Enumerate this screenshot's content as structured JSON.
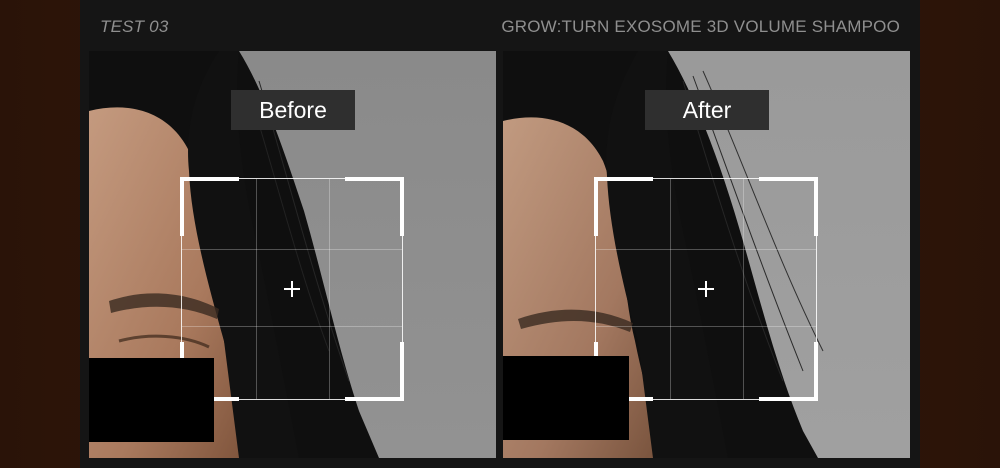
{
  "header": {
    "test_label": "TEST 03",
    "product_name": "GROW:TURN EXOSOME 3D VOLUME SHAMPOO"
  },
  "panels": [
    {
      "id": "before",
      "label": "Before"
    },
    {
      "id": "after",
      "label": "After"
    }
  ],
  "icons": {
    "crosshair": "crosshair-icon"
  },
  "colors": {
    "background_outer": "#3a1c0c",
    "panel": "#151515",
    "header_text": "#8f8f8f",
    "label_bg": "#2f2f2f",
    "label_text": "#ffffff"
  }
}
